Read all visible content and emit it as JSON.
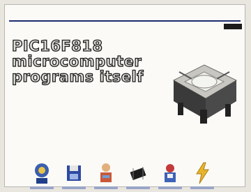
{
  "header": {
    "brand": "",
    "subline": "",
    "badge": ""
  },
  "article": {
    "title_lines": [
      "PIC16F818",
      "microcomputer",
      "programs itself"
    ],
    "body": ""
  },
  "product_image": {
    "icon": "chip-programmer-icon"
  },
  "footer_icons": [
    {
      "icon": "globe-person-icon"
    },
    {
      "icon": "floppy-disk-icon"
    },
    {
      "icon": "person-icon"
    },
    {
      "icon": "chip-icon"
    },
    {
      "icon": "badge-icon"
    },
    {
      "icon": "lightning-icon"
    }
  ],
  "colors": {
    "brand": "#1d2b6b",
    "body_text": "#2b2f55",
    "card_bg": "#fbfaf7"
  }
}
